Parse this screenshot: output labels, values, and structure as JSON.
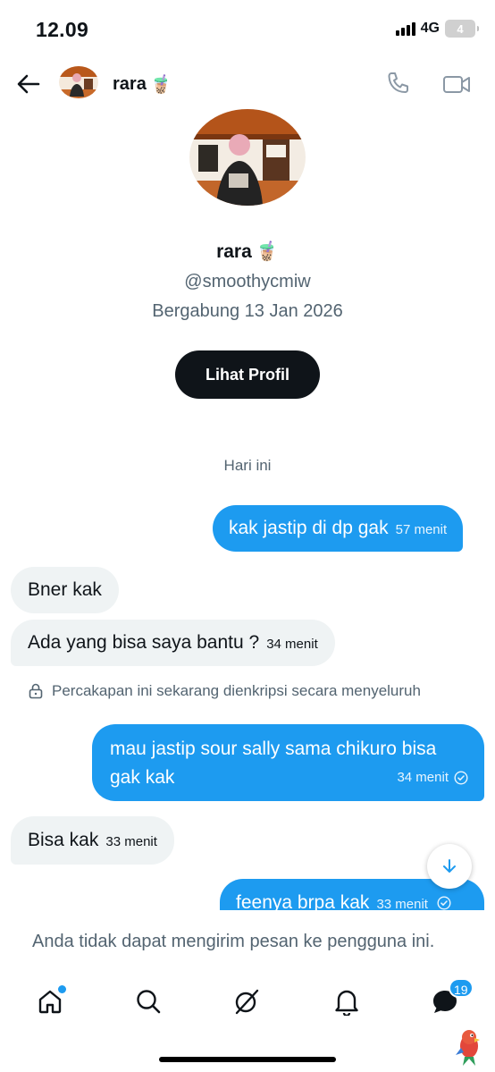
{
  "status": {
    "time": "12.09",
    "network": "4G",
    "battery": "4"
  },
  "header": {
    "name": "rara",
    "name_emoji": "🧋"
  },
  "profile": {
    "name": "rara",
    "name_emoji": "🧋",
    "handle": "@smoothycmiw",
    "joined": "Bergabung 13 Jan 2026",
    "view_button": "Lihat Profil"
  },
  "chat": {
    "day_label": "Hari ini",
    "encryption_note": "Percakapan ini sekarang dienkripsi secara menyeluruh",
    "messages": [
      {
        "dir": "out",
        "text": "kak jastip di dp gak",
        "time": "57 menit"
      },
      {
        "dir": "in",
        "text": "Bner kak",
        "time": ""
      },
      {
        "dir": "in",
        "text": "Ada yang bisa saya bantu ?",
        "time": "34 menit"
      },
      {
        "dir": "out",
        "text": "mau jastip sour sally sama chikuro bisa gak kak",
        "time": "34 menit",
        "status": "sent-check"
      },
      {
        "dir": "in",
        "text": "Bisa kak",
        "time": "33 menit"
      },
      {
        "dir": "out",
        "text": "feenya brpa kak",
        "time": "33 menit",
        "status": "sent-check"
      }
    ]
  },
  "composer": {
    "disabled_text": "Anda tidak dapat mengirim pesan ke pengguna ini."
  },
  "nav": {
    "messages_badge": "19"
  },
  "colors": {
    "accent": "#1d9bf0",
    "incoming_bubble": "#eff3f4",
    "dark_button": "#0f1419"
  }
}
